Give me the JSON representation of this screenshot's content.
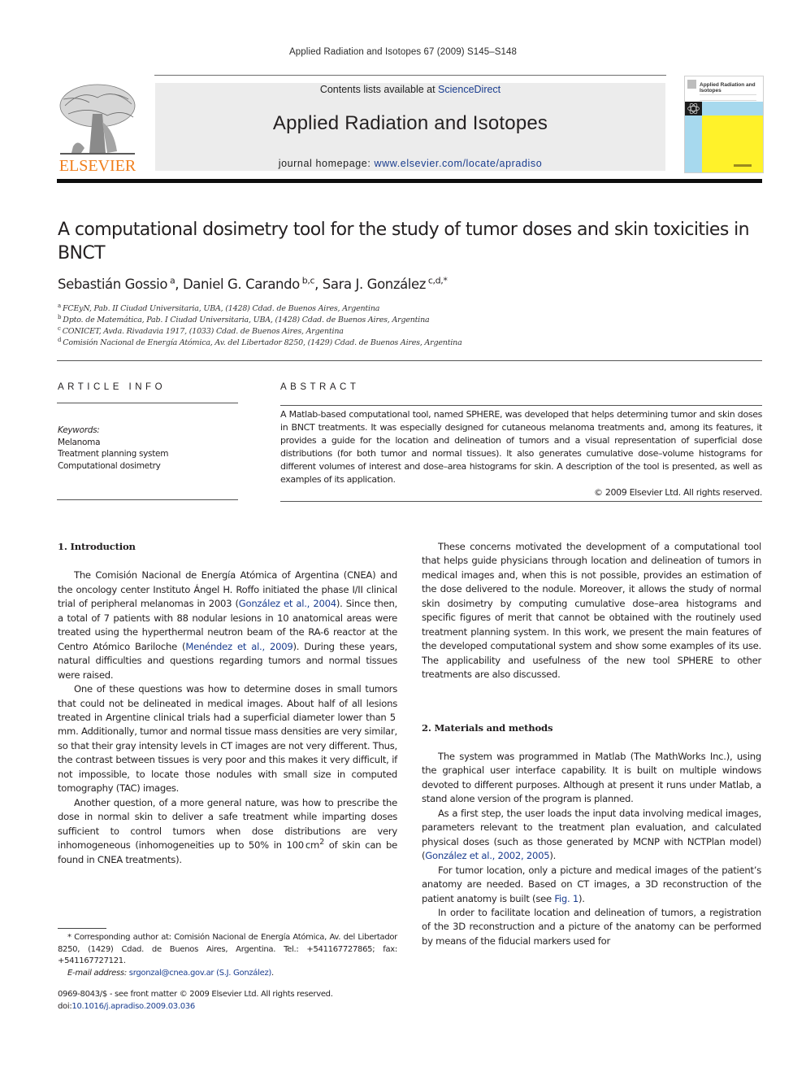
{
  "running_head": "Applied Radiation and Isotopes 67 (2009) S145–S148",
  "header": {
    "publisher_logo_text": "ELSEVIER",
    "contents_prefix": "Contents lists available at ",
    "contents_link": "ScienceDirect",
    "journal_title": "Applied Radiation and Isotopes",
    "homepage_prefix": "journal homepage: ",
    "homepage_link": "www.elsevier.com/locate/apradiso",
    "cover_title": "Applied Radiation and Isotopes",
    "colors": {
      "logo_orange": "#f07e1b",
      "link_blue": "#1a3d8f",
      "banner_gray": "#ececec",
      "cover_blue": "#a7d9ee",
      "cover_yellow": "#fff22a"
    }
  },
  "article": {
    "title": "A computational dosimetry tool for the study of tumor doses and skin toxicities in BNCT",
    "authors": [
      {
        "name": "Sebastián Gossio",
        "sup": "a",
        "sep": ", "
      },
      {
        "name": "Daniel G. Carando",
        "sup": "b,c",
        "sep": ", "
      },
      {
        "name": "Sara J. González",
        "sup": "c,d,*",
        "sep": ""
      }
    ],
    "affiliations": [
      {
        "mark": "a",
        "text": "FCEyN, Pab. II Ciudad Universitaria, UBA, (1428) Cdad. de Buenos Aires, Argentina"
      },
      {
        "mark": "b",
        "text": "Dpto. de Matemática, Pab. I Ciudad Universitaria, UBA, (1428) Cdad. de Buenos Aires, Argentina"
      },
      {
        "mark": "c",
        "text": "CONICET, Avda. Rivadavia 1917, (1033) Cdad. de Buenos Aires, Argentina"
      },
      {
        "mark": "d",
        "text": "Comisión Nacional de Energía Atómica, Av. del Libertador 8250, (1429) Cdad. de Buenos Aires, Argentina"
      }
    ]
  },
  "article_info": {
    "label": "ARTICLE INFO",
    "keywords_label": "Keywords:",
    "keywords": [
      "Melanoma",
      "Treatment planning system",
      "Computational dosimetry"
    ]
  },
  "abstract": {
    "label": "ABSTRACT",
    "text": "A Matlab-based computational tool, named SPHERE, was developed that helps determining tumor and skin doses in BNCT treatments. It was especially designed for cutaneous melanoma treatments and, among its features, it provides a guide for the location and delineation of tumors and a visual representation of superficial dose distributions (for both tumor and normal tissues). It also generates cumulative dose–volume histograms for different volumes of interest and dose–area histograms for skin. A description of the tool is presented, as well as examples of its application.",
    "copyright": "© 2009 Elsevier Ltd. All rights reserved."
  },
  "body": {
    "sec1_heading": "1.  Introduction",
    "sec1_p1": {
      "a": "The Comisión Nacional de Energía Atómica of Argentina (CNEA) and the oncology center Instituto Ángel H. Roffo initiated the phase I/II clinical trial of peripheral melanomas in 2003 (",
      "ref1": "González et al., 2004",
      "b": "). Since then, a total of 7 patients with 88 nodular lesions in 10 anatomical areas were treated using the hyperthermal neutron beam of the RA-6 reactor at the Centro Atómico Bariloche (",
      "ref2": "Menéndez et al., 2009",
      "c": "). During these years, natural difficulties and questions regarding tumors and normal tissues were raised."
    },
    "sec1_p2": "One of these questions was how to determine doses in small tumors that could not be delineated in medical images. About half of all lesions treated in Argentine clinical trials had a superficial diameter lower than 5 mm. Additionally, tumor and normal tissue mass densities are very similar, so that their gray intensity levels in CT images are not very different. Thus, the contrast between tissues is very poor and this makes it very difficult, if not impossible, to locate those nodules with small size in computed tomography (TAC) images.",
    "sec1_p3": {
      "a": "Another question, of a more general nature, was how to prescribe the dose in normal skin to deliver a safe treatment while imparting doses sufficient to control tumors when dose distributions are very inhomogeneous (inhomogeneities up to 50% in 100 cm",
      "sup": "2",
      "b": " of skin can be found in CNEA treatments)."
    },
    "sec1_p4": "These concerns motivated the development of a computational tool that helps guide physicians through location and delineation of tumors in medical images and, when this is not possible, provides an estimation of the dose delivered to the nodule. Moreover, it allows the study of normal skin dosimetry by computing cumulative dose–area histograms and specific figures of merit that cannot be obtained with the routinely used treatment planning system. In this work, we present the main features of the developed computational system and show some examples of its use. The applicability and usefulness of the new tool SPHERE to other treatments are also discussed.",
    "sec2_heading": "2.  Materials and methods",
    "sec2_p1": "The system was programmed in Matlab (The MathWorks Inc.), using the graphical user interface capability. It is built on multiple windows devoted to different purposes. Although at present it runs under Matlab, a stand alone version of the program is planned.",
    "sec2_p2": {
      "a": "As a first step, the user loads the input data involving medical images, parameters relevant to the treatment plan evaluation, and calculated physical doses (such as those generated by MCNP with NCTPlan model) (",
      "ref": "González et al., 2002, 2005",
      "b": ")."
    },
    "sec2_p3": {
      "a": "For tumor location, only a picture and medical images of the patient’s anatomy are needed. Based on CT images, a 3D reconstruction of the patient anatomy is built (see ",
      "ref": "Fig. 1",
      "b": ")."
    },
    "sec2_p4": "In order to facilitate location and delineation of tumors, a registration of the 3D reconstruction and a picture of the anatomy can be performed by means of the fiducial markers used for"
  },
  "footnote": {
    "corresponding": "* Corresponding author at: Comisión Nacional de Energía Atómica, Av. del Libertador 8250, (1429) Cdad. de Buenos Aires, Argentina. Tel.: +541167727865; fax: +541167727121.",
    "email_label": "E-mail address: ",
    "email": "srgonzal@cnea.gov.ar",
    "email_name": " (S.J. González)",
    "email_end": "."
  },
  "front_matter": {
    "issn_line": "0969-8043/$ - see front matter © 2009 Elsevier Ltd. All rights reserved.",
    "doi_prefix": "doi:",
    "doi": "10.1016/j.apradiso.2009.03.036"
  }
}
